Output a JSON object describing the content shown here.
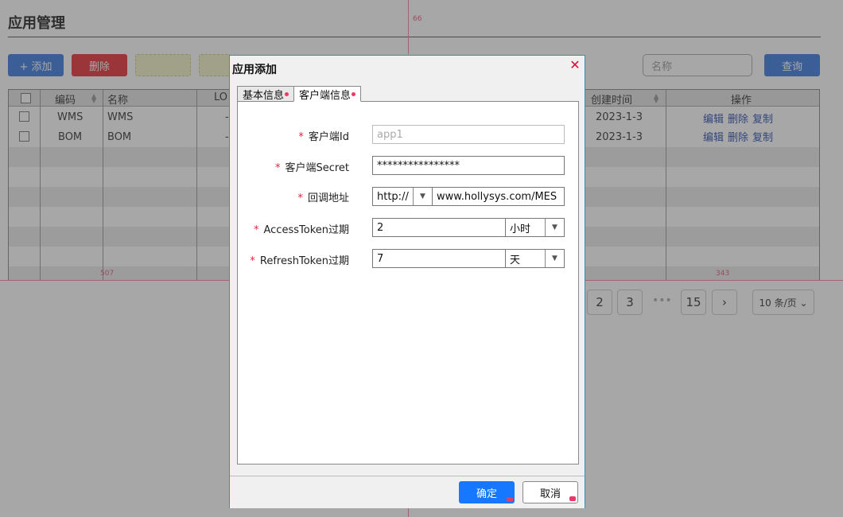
{
  "page": {
    "title": "应用管理",
    "toolbar": {
      "add_label": "+ 添加",
      "delete_label": "删除",
      "query_label": "查询"
    },
    "search": {
      "placeholder": "名称"
    },
    "table": {
      "headers": [
        "编码",
        "名称",
        "LO",
        "创建时间",
        "操作"
      ],
      "rows": [
        {
          "code": "WMS",
          "name": "WMS",
          "lo": "-",
          "created": "2023-1-3",
          "actions": [
            "编辑",
            "删除",
            "复制"
          ]
        },
        {
          "code": "BOM",
          "name": "BOM",
          "lo": "-",
          "created": "2023-1-3",
          "actions": [
            "编辑",
            "删除",
            "复制"
          ]
        }
      ]
    },
    "pager": {
      "pages": [
        "2",
        "3",
        "15"
      ],
      "ellipsis": "•••",
      "next": "›",
      "page_size": "10 条/页 ⌄"
    },
    "guides": {
      "top": "66",
      "left": "507",
      "right": "343"
    }
  },
  "dialog": {
    "title": "应用添加",
    "tabs": [
      {
        "label": "基本信息",
        "active": false
      },
      {
        "label": "客户端信息",
        "active": true
      }
    ],
    "required_mark": "*",
    "form": {
      "client_id": {
        "label": "客户端Id",
        "placeholder": "app1"
      },
      "client_secret": {
        "label": "客户端Secret",
        "value": "****************"
      },
      "callback": {
        "label": "回调地址",
        "protocol": "http://",
        "host": "www.hollysys.com/MES"
      },
      "access_token": {
        "label": "AccessToken过期",
        "value": "2",
        "unit": "小时"
      },
      "refresh_token": {
        "label": "RefreshToken过期",
        "value": "7",
        "unit": "天"
      }
    },
    "buttons": {
      "ok": "确定",
      "cancel": "取消"
    }
  },
  "colors": {
    "primary": "#1677ff",
    "danger": "#e8323a",
    "required": "#e0243a",
    "dialog_border": "#3a8fa8"
  }
}
